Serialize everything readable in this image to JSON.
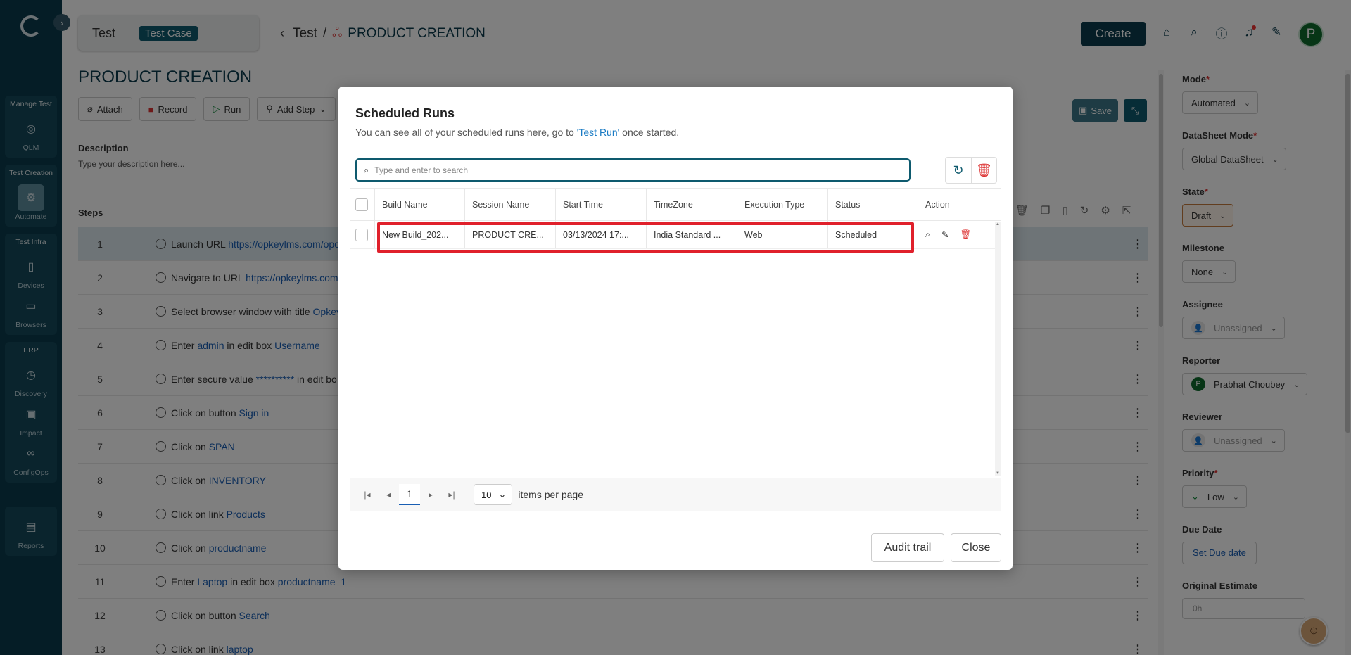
{
  "sidebar": {
    "groups": [
      {
        "title": "Manage Test",
        "items": [
          {
            "label": "QLM",
            "icon": "target-icon",
            "glyph": "◎",
            "active": false
          }
        ]
      },
      {
        "title": "Test Creation",
        "items": [
          {
            "label": "Automate",
            "icon": "automate-icon",
            "glyph": "⚙",
            "active": true
          }
        ]
      },
      {
        "title": "Test Infra",
        "items": [
          {
            "label": "Devices",
            "icon": "device-icon",
            "glyph": "▯",
            "active": false
          },
          {
            "label": "Browsers",
            "icon": "monitor-icon",
            "glyph": "▭",
            "active": false
          }
        ]
      },
      {
        "title": "ERP",
        "items": [
          {
            "label": "Discovery",
            "icon": "compass-icon",
            "glyph": "◷",
            "active": false
          },
          {
            "label": "Impact",
            "icon": "impact-icon",
            "glyph": "▣",
            "active": false
          },
          {
            "label": "ConfigOps",
            "icon": "link-icon",
            "glyph": "∞",
            "active": false
          }
        ]
      },
      {
        "title": "",
        "items": [
          {
            "label": "Reports",
            "icon": "report-icon",
            "glyph": "▤",
            "active": false
          }
        ]
      }
    ]
  },
  "header": {
    "tab_title": "Test",
    "tab_badge": "Test Case",
    "breadcrumb_root": "Test",
    "breadcrumb_sep": "/",
    "breadcrumb_current": "PRODUCT CREATION",
    "create_label": "Create",
    "avatar_letter": "P"
  },
  "page": {
    "title": "PRODUCT CREATION",
    "tools": {
      "attach": "Attach",
      "record": "Record",
      "run": "Run",
      "add_step": "Add Step"
    },
    "description_label": "Description",
    "description_placeholder": "Type your description here...",
    "steps_label": "Steps",
    "save_label": "Save",
    "steps": [
      {
        "num": "1",
        "parts": [
          [
            "Launch URL ",
            false
          ],
          [
            "https://opkeylms.com/opcr",
            true
          ]
        ]
      },
      {
        "num": "2",
        "parts": [
          [
            "Navigate to URL ",
            false
          ],
          [
            "https://opkeylms.com/c",
            true
          ]
        ]
      },
      {
        "num": "3",
        "parts": [
          [
            "Select browser window with title ",
            false
          ],
          [
            "Opkey",
            true
          ]
        ]
      },
      {
        "num": "4",
        "parts": [
          [
            "Enter ",
            false
          ],
          [
            "admin",
            true
          ],
          [
            " in edit box ",
            false
          ],
          [
            "Username",
            true
          ]
        ]
      },
      {
        "num": "5",
        "parts": [
          [
            "Enter secure value ",
            false
          ],
          [
            "**********",
            true
          ],
          [
            " in edit bo",
            false
          ]
        ]
      },
      {
        "num": "6",
        "parts": [
          [
            "Click on button ",
            false
          ],
          [
            "Sign in",
            true
          ]
        ]
      },
      {
        "num": "7",
        "parts": [
          [
            "Click on ",
            false
          ],
          [
            "SPAN",
            true
          ]
        ]
      },
      {
        "num": "8",
        "parts": [
          [
            "Click on ",
            false
          ],
          [
            "INVENTORY",
            true
          ]
        ]
      },
      {
        "num": "9",
        "parts": [
          [
            "Click on link ",
            false
          ],
          [
            "Products",
            true
          ]
        ]
      },
      {
        "num": "10",
        "parts": [
          [
            "Click on ",
            false
          ],
          [
            "productname",
            true
          ]
        ]
      },
      {
        "num": "11",
        "parts": [
          [
            "Enter ",
            false
          ],
          [
            "Laptop",
            true
          ],
          [
            " in edit box ",
            false
          ],
          [
            "productname_1",
            true
          ]
        ]
      },
      {
        "num": "12",
        "parts": [
          [
            "Click on button ",
            false
          ],
          [
            "Search",
            true
          ]
        ]
      },
      {
        "num": "13",
        "parts": [
          [
            "Click on link ",
            false
          ],
          [
            "laptop",
            true
          ]
        ]
      }
    ]
  },
  "right_panel": {
    "mode_label": "Mode",
    "mode_value": "Automated",
    "datasheet_label": "DataSheet Mode",
    "datasheet_value": "Global DataSheet",
    "state_label": "State",
    "state_value": "Draft",
    "milestone_label": "Milestone",
    "milestone_value": "None",
    "assignee_label": "Assignee",
    "assignee_value": "Unassigned",
    "reporter_label": "Reporter",
    "reporter_value": "Prabhat Choubey",
    "reporter_initial": "P",
    "reviewer_label": "Reviewer",
    "reviewer_value": "Unassigned",
    "priority_label": "Priority",
    "priority_value": "Low",
    "due_label": "Due Date",
    "due_button": "Set Due date",
    "estimate_label": "Original Estimate",
    "estimate_placeholder": "0h",
    "required_mark": "*"
  },
  "modal": {
    "title": "Scheduled Runs",
    "subtitle_pre": "You can see all of your scheduled runs here, go to ",
    "subtitle_link": "'Test Run'",
    "subtitle_post": " once started.",
    "search_placeholder": "Type and enter to search",
    "columns": [
      "Build Name",
      "Session Name",
      "Start Time",
      "TimeZone",
      "Execution Type",
      "Status",
      "Action"
    ],
    "rows": [
      {
        "build": "New Build_202...",
        "session": "PRODUCT CRE...",
        "start": "03/13/2024 17:...",
        "tz": "India Standard ...",
        "exec": "Web",
        "status": "Scheduled"
      }
    ],
    "pager": {
      "page": "1",
      "size": "10",
      "items_label": "items per page"
    },
    "audit_label": "Audit trail",
    "close_label": "Close",
    "highlight_color": "#e0202b"
  }
}
